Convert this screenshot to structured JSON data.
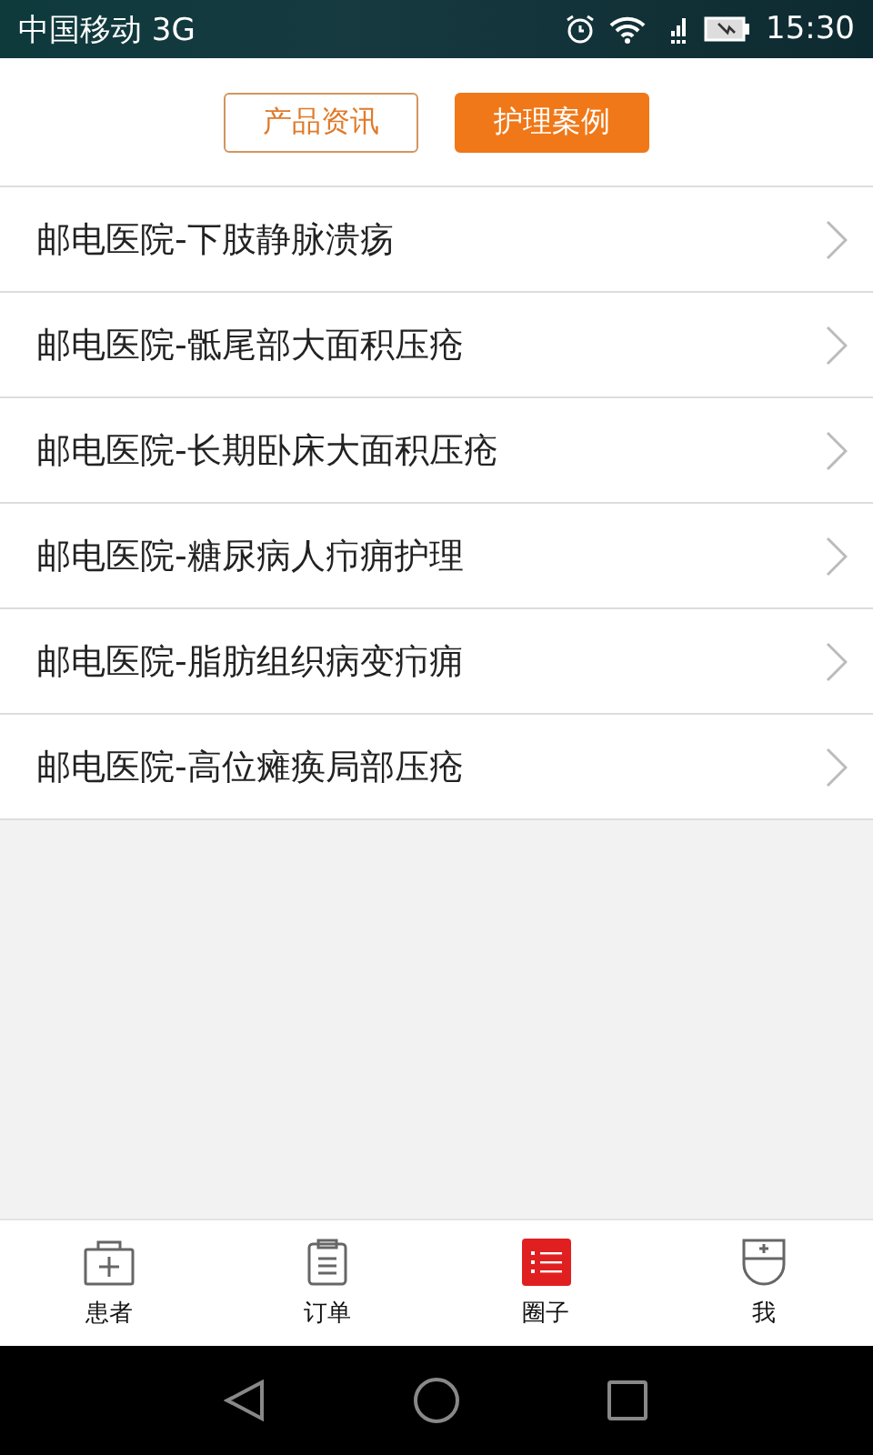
{
  "status_bar": {
    "carrier": "中国移动 3G",
    "time": "15:30"
  },
  "segments": [
    {
      "label": "产品资讯",
      "selected": false
    },
    {
      "label": "护理案例",
      "selected": true
    }
  ],
  "list": [
    {
      "title": "邮电医院-下肢静脉溃疡"
    },
    {
      "title": "邮电医院-骶尾部大面积压疮"
    },
    {
      "title": "邮电医院-长期卧床大面积压疮"
    },
    {
      "title": "邮电医院-糖尿病人疖痈护理"
    },
    {
      "title": "邮电医院-脂肪组织病变疖痈"
    },
    {
      "title": "邮电医院-高位瘫痪局部压疮"
    }
  ],
  "tab_bar": [
    {
      "kind": "patient",
      "label": "患者",
      "selected": false
    },
    {
      "kind": "orders",
      "label": "订单",
      "selected": false
    },
    {
      "kind": "circle",
      "label": "圈子",
      "selected": true
    },
    {
      "kind": "me",
      "label": "我",
      "selected": false
    }
  ]
}
